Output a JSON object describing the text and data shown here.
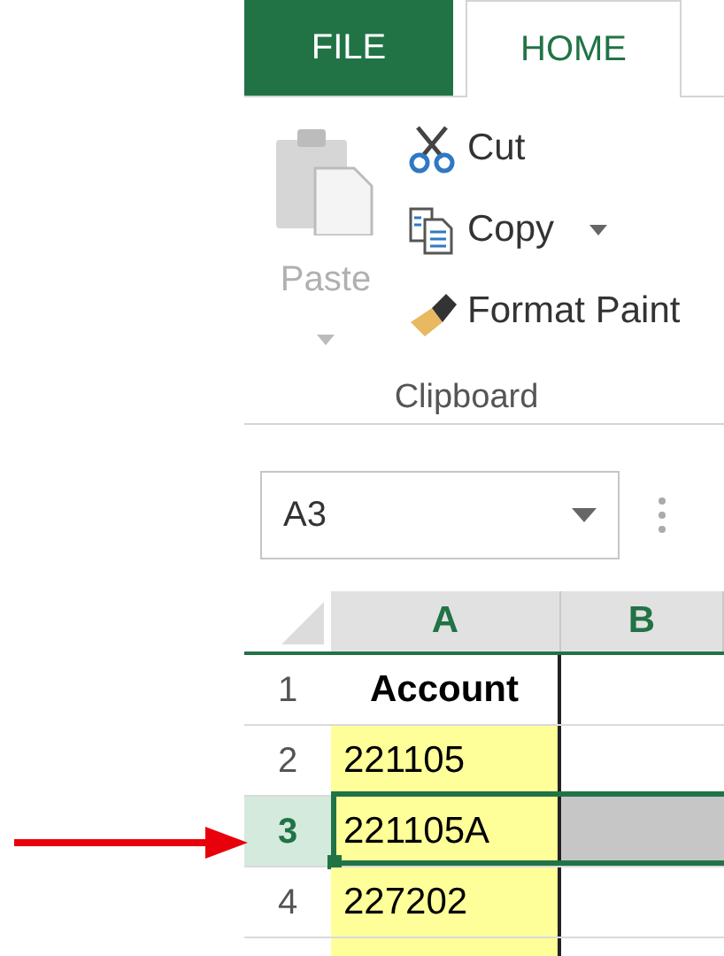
{
  "tabs": [
    {
      "label": "FILE",
      "kind": "file",
      "selected": false
    },
    {
      "label": "HOME",
      "kind": "tab",
      "selected": true
    }
  ],
  "clipboard": {
    "paste": {
      "label": "Paste",
      "disabled": true
    },
    "commands": [
      {
        "label": "Cut",
        "kind": "cut",
        "dropdown": false
      },
      {
        "label": "Copy",
        "kind": "copy",
        "dropdown": true
      },
      {
        "label": "Format Paint",
        "kind": "painter",
        "dropdown": false
      }
    ],
    "group_label": "Clipboard"
  },
  "name_box": {
    "value": "A3"
  },
  "columns": [
    {
      "label": "A",
      "selected": true
    },
    {
      "label": "B",
      "selected": true
    }
  ],
  "rows": [
    {
      "header": "1",
      "selected": false,
      "cells": [
        {
          "text": "Account",
          "bold": true,
          "highlighted": false
        }
      ]
    },
    {
      "header": "2",
      "selected": false,
      "cells": [
        {
          "text": "221105",
          "bold": false,
          "highlighted": true
        }
      ]
    },
    {
      "header": "3",
      "selected": true,
      "cells": [
        {
          "text": "221105A",
          "bold": false,
          "highlighted": true
        }
      ]
    },
    {
      "header": "4",
      "selected": false,
      "cells": [
        {
          "text": "227202",
          "bold": false,
          "highlighted": true
        }
      ]
    }
  ]
}
